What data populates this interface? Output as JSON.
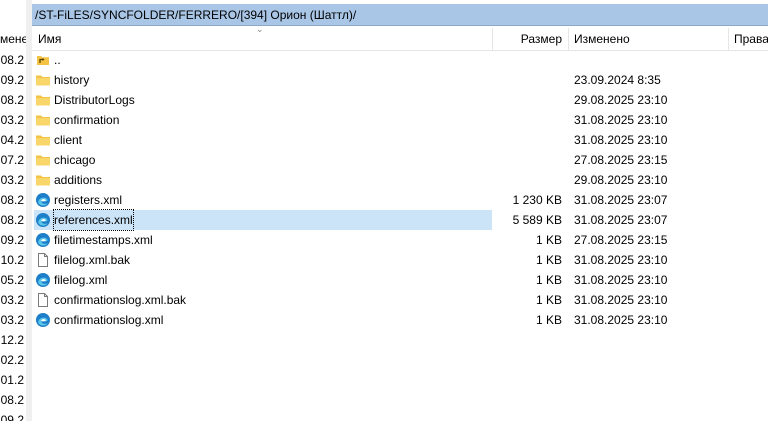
{
  "left_pane": {
    "header": "мене",
    "rows": [
      ".08.2",
      ".09.2",
      ".08.2",
      ".03.2",
      ".04.2",
      ".07.2",
      ".03.2",
      ".08.2",
      ".08.2",
      ".09.2",
      ".10.2",
      ".05.2",
      ".03.2",
      ".03.2",
      ".12.2",
      ".02.2",
      ".01.2",
      ".08.2",
      ".09.2"
    ]
  },
  "path_bar": {
    "text": "/ST-FiLES/SYNCFOLDER/FERRERO/[394] Орион (Шаттл)/"
  },
  "columns": {
    "name": "Имя",
    "size": "Размер",
    "modified": "Изменено",
    "rights": "Права"
  },
  "files": [
    {
      "icon": "parent-folder-icon",
      "name": "..",
      "size": "",
      "modified": ""
    },
    {
      "icon": "folder-icon",
      "name": "history",
      "size": "",
      "modified": "23.09.2024 8:35"
    },
    {
      "icon": "folder-icon",
      "name": "DistributorLogs",
      "size": "",
      "modified": "29.08.2025 23:10"
    },
    {
      "icon": "folder-icon",
      "name": "confirmation",
      "size": "",
      "modified": "31.08.2025 23:10"
    },
    {
      "icon": "folder-icon",
      "name": "client",
      "size": "",
      "modified": "31.08.2025 23:10"
    },
    {
      "icon": "folder-icon",
      "name": "chicago",
      "size": "",
      "modified": "27.08.2025 23:15"
    },
    {
      "icon": "folder-icon",
      "name": "additions",
      "size": "",
      "modified": "29.08.2025 23:10"
    },
    {
      "icon": "edge-icon",
      "name": "registers.xml",
      "size": "1 230 KB",
      "modified": "31.08.2025 23:07"
    },
    {
      "icon": "edge-icon",
      "name": "references.xml",
      "size": "5 589 KB",
      "modified": "31.08.2025 23:07",
      "selected": true
    },
    {
      "icon": "edge-icon",
      "name": "filetimestamps.xml",
      "size": "1 KB",
      "modified": "27.08.2025 23:15"
    },
    {
      "icon": "file-icon",
      "name": "filelog.xml.bak",
      "size": "1 KB",
      "modified": "31.08.2025 23:10"
    },
    {
      "icon": "edge-icon",
      "name": "filelog.xml",
      "size": "1 KB",
      "modified": "31.08.2025 23:10"
    },
    {
      "icon": "file-icon",
      "name": "confirmationslog.xml.bak",
      "size": "1 KB",
      "modified": "31.08.2025 23:10"
    },
    {
      "icon": "edge-icon",
      "name": "confirmationslog.xml",
      "size": "1 KB",
      "modified": "31.08.2025 23:10"
    }
  ]
}
